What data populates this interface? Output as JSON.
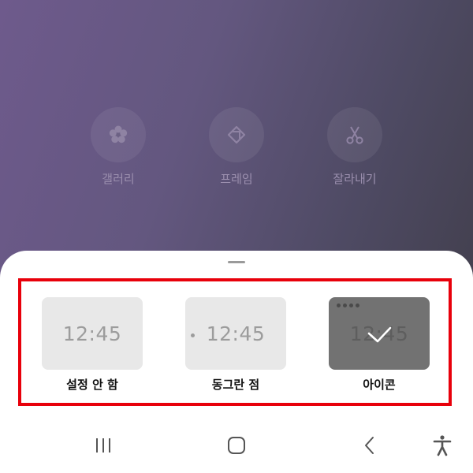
{
  "wallpaper_tools": [
    {
      "label": "갤러리",
      "icon": "flower-icon"
    },
    {
      "label": "프레임",
      "icon": "frame-icon"
    },
    {
      "label": "잘라내기",
      "icon": "scissors-icon"
    }
  ],
  "sheet": {
    "options": [
      {
        "label": "설정 안 함",
        "time": "12:45",
        "style": "none",
        "selected": false
      },
      {
        "label": "동그란 점",
        "time": "12:45",
        "style": "dot",
        "selected": false
      },
      {
        "label": "아이콘",
        "time": "12:45",
        "style": "icon",
        "selected": true
      }
    ]
  },
  "navbar": {
    "recents": "recents-icon",
    "home": "home-icon",
    "back": "back-icon",
    "accessibility": "accessibility-icon"
  },
  "colors": {
    "highlight": "#e8000b",
    "thumb": "#e8e8e8",
    "thumb_selected": "#727272"
  }
}
